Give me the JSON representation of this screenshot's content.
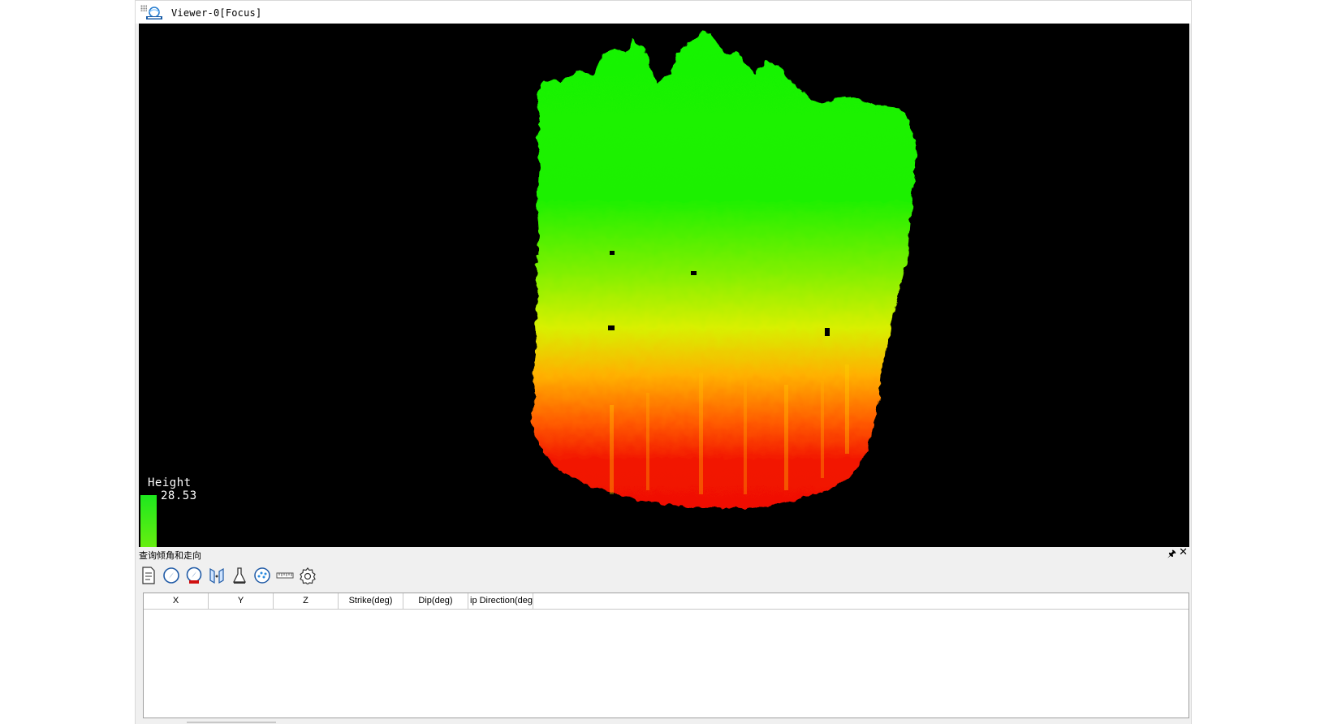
{
  "viewer": {
    "title": "Viewer-0[Focus]",
    "logo_icon": "app-logo-icon",
    "background": "#000000"
  },
  "legend": {
    "title": "Height",
    "value": "28.53",
    "bar_color": "#1ee81e"
  },
  "point_cloud": {
    "description_colors": {
      "top": "#11f000",
      "middle": "#c8f000",
      "lower": "#ff8800",
      "bottom": "#f01000"
    }
  },
  "panel": {
    "title": "查询倾角和走向",
    "pin_icon": "pin-icon",
    "close_icon": "close-icon",
    "toolbar": [
      {
        "name": "document-icon"
      },
      {
        "name": "compass-icon"
      },
      {
        "name": "compass-auto-icon"
      },
      {
        "name": "plane-fit-icon"
      },
      {
        "name": "flask-icon"
      },
      {
        "name": "scatter-icon"
      },
      {
        "name": "ruler-icon"
      },
      {
        "name": "settings-icon"
      }
    ],
    "table": {
      "columns": [
        "X",
        "Y",
        "Z",
        "Strike(deg)",
        "Dip(deg)",
        "ip Direction(deg"
      ],
      "rows": []
    }
  }
}
